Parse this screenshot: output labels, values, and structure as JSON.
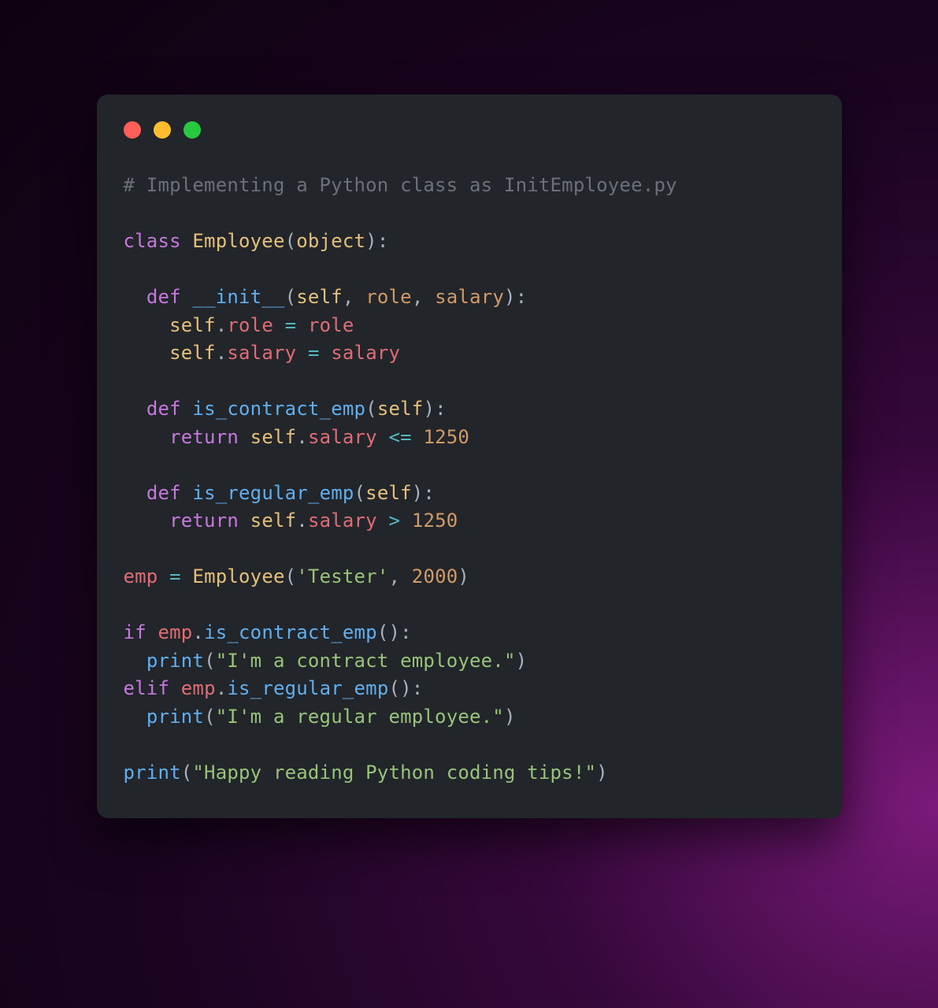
{
  "colors": {
    "window_bg": "#22252a",
    "dot_red": "#ff5f57",
    "dot_yellow": "#febc2e",
    "dot_green": "#28c840",
    "comment": "#6c7079",
    "keyword": "#c678dd",
    "classname": "#e5c07b",
    "func": "#61afef",
    "ident": "#e06c75",
    "param": "#d19a66",
    "op": "#56b6c2",
    "punct": "#abb2bf",
    "number": "#d19a66",
    "string": "#98c379"
  },
  "code": {
    "comment_line": "# Implementing a Python class as InitEmployee.py",
    "kw_class": "class",
    "class_name": "Employee",
    "base": "object",
    "kw_def": "def",
    "fn_init": "__init__",
    "kw_self": "self",
    "p_role": "role",
    "p_salary": "salary",
    "attr_role": "role",
    "attr_salary": "salary",
    "fn_is_contract": "is_contract_emp",
    "fn_is_regular": "is_regular_emp",
    "kw_return": "return",
    "op_le": "<=",
    "op_gt": ">",
    "op_eq": "=",
    "num_1250": "1250",
    "var_emp": "emp",
    "str_tester": "'Tester'",
    "num_2000": "2000",
    "kw_if": "if",
    "kw_elif": "elif",
    "fn_print": "print",
    "str_contract": "\"I'm a contract employee.\"",
    "str_regular": "\"I'm a regular employee.\"",
    "str_happy": "\"Happy reading Python coding tips!\""
  }
}
